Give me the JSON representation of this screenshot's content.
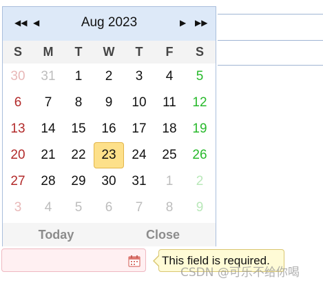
{
  "calendar": {
    "nav": {
      "prev_year_icon": "double-left-arrow",
      "prev_month_icon": "left-arrow",
      "next_month_icon": "right-arrow",
      "next_year_icon": "double-right-arrow"
    },
    "month_title": "Aug 2023",
    "weekdays": [
      "S",
      "M",
      "T",
      "W",
      "T",
      "F",
      "S"
    ],
    "weeks": [
      [
        "30",
        "31",
        "1",
        "2",
        "3",
        "4",
        "5"
      ],
      [
        "6",
        "7",
        "8",
        "9",
        "10",
        "11",
        "12"
      ],
      [
        "13",
        "14",
        "15",
        "16",
        "17",
        "18",
        "19"
      ],
      [
        "20",
        "21",
        "22",
        "23",
        "24",
        "25",
        "26"
      ],
      [
        "27",
        "28",
        "29",
        "30",
        "31",
        "1",
        "2"
      ],
      [
        "3",
        "4",
        "5",
        "6",
        "7",
        "8",
        "9"
      ]
    ],
    "selected_day": "23",
    "footer": {
      "today_label": "Today",
      "close_label": "Close"
    }
  },
  "date_input": {
    "value": "",
    "icon": "calendar-icon"
  },
  "validation": {
    "message": "This field is required."
  },
  "watermark": "CSDN @可乐不给你喝",
  "colors": {
    "header_bg": "#dde9f8",
    "selected_bg": "#fde08a",
    "sunday": "#b22a2a",
    "saturday": "#27b92b",
    "invalid_bg": "#fff0f2",
    "tooltip_bg": "#fffbd6"
  }
}
